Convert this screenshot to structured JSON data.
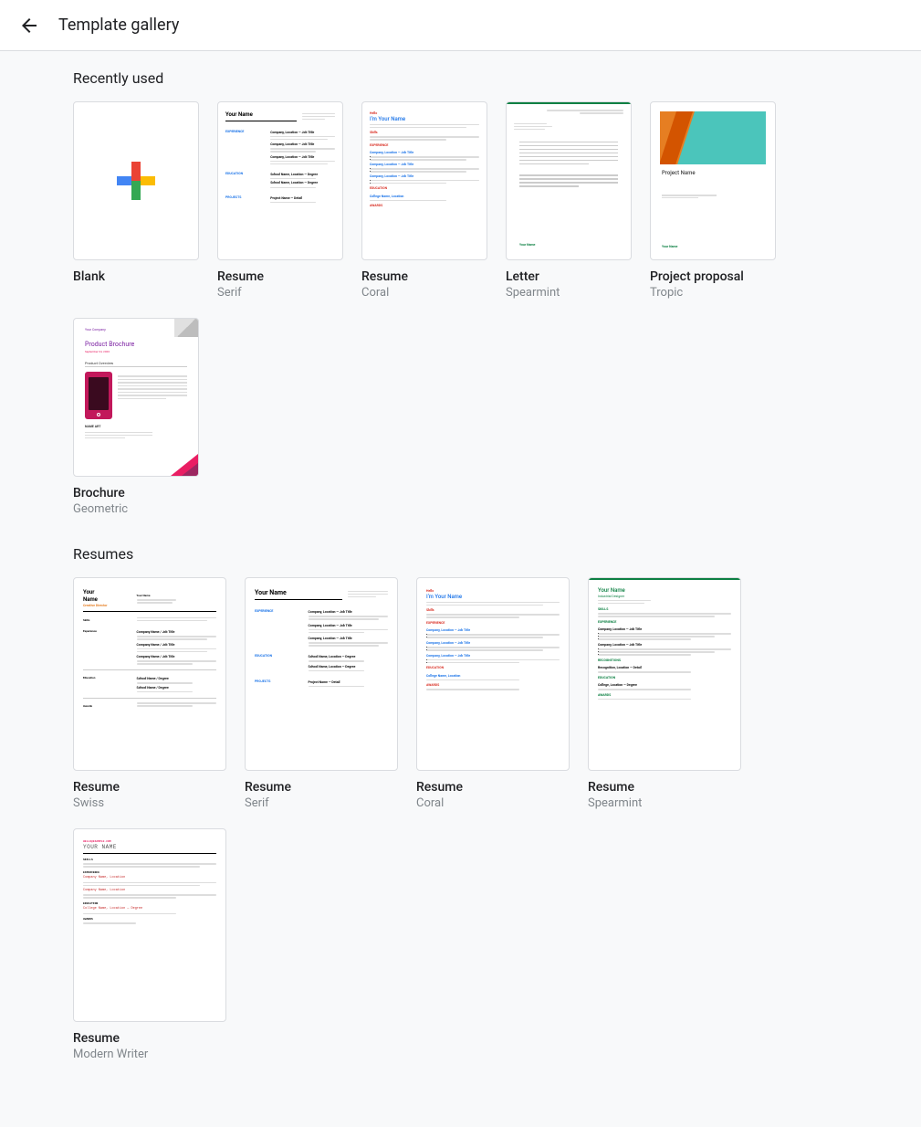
{
  "header": {
    "title": "Template gallery"
  },
  "sections": {
    "recent": {
      "title": "Recently used",
      "items": [
        {
          "title": "Blank",
          "subtitle": ""
        },
        {
          "title": "Resume",
          "subtitle": "Serif"
        },
        {
          "title": "Resume",
          "subtitle": "Coral"
        },
        {
          "title": "Letter",
          "subtitle": "Spearmint"
        },
        {
          "title": "Project proposal",
          "subtitle": "Tropic"
        },
        {
          "title": "Brochure",
          "subtitle": "Geometric"
        }
      ]
    },
    "resumes": {
      "title": "Resumes",
      "items": [
        {
          "title": "Resume",
          "subtitle": "Swiss"
        },
        {
          "title": "Resume",
          "subtitle": "Serif"
        },
        {
          "title": "Resume",
          "subtitle": "Coral"
        },
        {
          "title": "Resume",
          "subtitle": "Spearmint"
        },
        {
          "title": "Resume",
          "subtitle": "Modern Writer"
        }
      ]
    }
  },
  "preview": {
    "your_name": "Your Name",
    "im_your_name": "I'm Your Name",
    "project_name": "Project Name",
    "your_company": "Your Company",
    "product_brochure": "Product Brochure",
    "product_overview": "Product Overview",
    "creative_director": "Creative Director",
    "hello": "Hello",
    "skills": "Skills",
    "experience": "EXPERIENCE",
    "education": "EDUCATION",
    "projects": "PROJECTS",
    "awards": "AWARDS",
    "recognitions": "RECOGNITIONS"
  }
}
